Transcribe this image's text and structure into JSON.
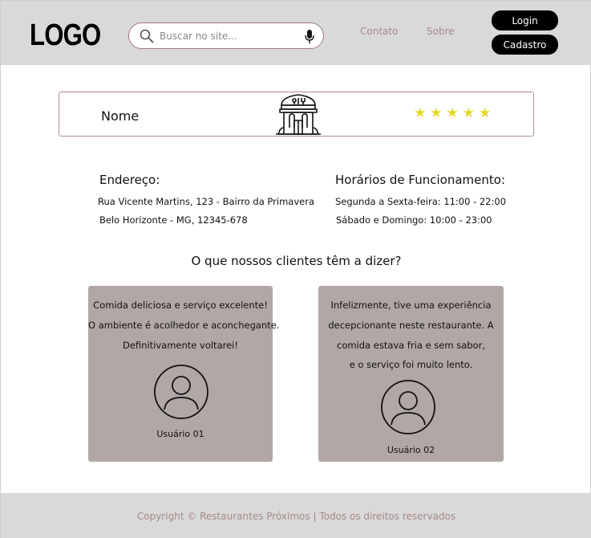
{
  "header": {
    "logo": "LOGO",
    "search": {
      "placeholder": "Buscar no site...",
      "value": ""
    },
    "nav": {
      "contato": "Contato",
      "sobre": "Sobre"
    },
    "buttons": {
      "login": "Login",
      "cadastro": "Cadastro"
    }
  },
  "restaurant": {
    "name": "Nome",
    "rating": 5,
    "stars": [
      "★",
      "★",
      "★",
      "★",
      "★"
    ]
  },
  "address": {
    "title": "Endereço:",
    "line1": "Rua Vicente Martins, 123 - Bairro da Primavera",
    "line2": "Belo Horizonte - MG, 12345-678"
  },
  "hours": {
    "title": "Horários de Funcionamento:",
    "line1": "Segunda a Sexta-feira: 11:00 - 22:00",
    "line2": "Sábado e Domingo: 10:00 - 23:00"
  },
  "reviews": {
    "title": "O que nossos clientes têm a dizer?",
    "items": [
      {
        "lines": [
          "Comida deliciosa e serviço excelente!",
          "O ambiente é acolhedor e aconchegante.",
          "Definitivamente voltarei!"
        ],
        "user": "Usuário 01"
      },
      {
        "lines": [
          "Infelizmente, tive uma experiência",
          "decepcionante neste restaurante. A",
          "comida estava fria e sem sabor,",
          "e o serviço foi muito lento."
        ],
        "user": "Usuário 02"
      }
    ]
  },
  "footer": {
    "copyright": "Copyright © Restaurantes Próximos | Todos os direitos reservados"
  },
  "colors": {
    "header_bg": "#d9d9d9",
    "card_bg": "#b1a7a7",
    "link": "#a58a8a",
    "star": "#e3dc27",
    "button_bg": "#000000"
  }
}
